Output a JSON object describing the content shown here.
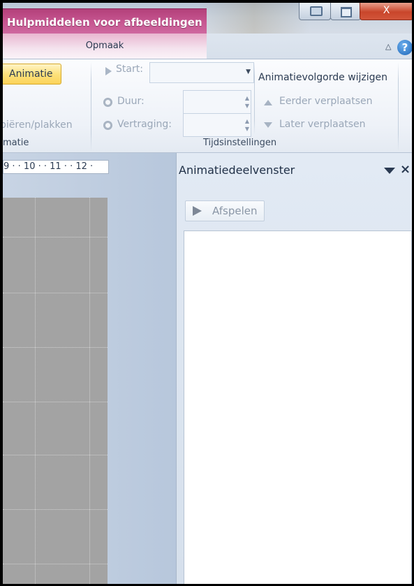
{
  "titlebar": {
    "contextual_group": "Hulpmiddelen voor afbeeldingen",
    "buttons": {
      "camera": "camera-icon",
      "restore": "restore-icon",
      "close": "X"
    }
  },
  "tabs": {
    "active": "Opmaak",
    "help": "?",
    "collapse": "△"
  },
  "ribbon": {
    "animatie_button": "Animatie",
    "copy_paste": "piëren/plakken",
    "animatie_group": "matie",
    "start_label": "Start:",
    "start_value": "",
    "duur_label": "Duur:",
    "duur_value": "",
    "vertraging_label": "Vertraging:",
    "vertraging_value": "",
    "timing_group": "Tijdsinstellingen",
    "reorder_title": "Animatievolgorde wijzigen",
    "move_earlier": "Eerder verplaatsen",
    "move_later": "Later verplaatsen"
  },
  "ruler": {
    "text": "9 · · 10 · · 11 · · 12 ·"
  },
  "pane": {
    "title": "Animatiedeelvenster",
    "close": "×",
    "play_button": "Afspelen",
    "items": []
  },
  "colors": {
    "context_tab": "#c65590",
    "animatie_highlight": "#fde27c",
    "slide": "#a3a3a3"
  }
}
